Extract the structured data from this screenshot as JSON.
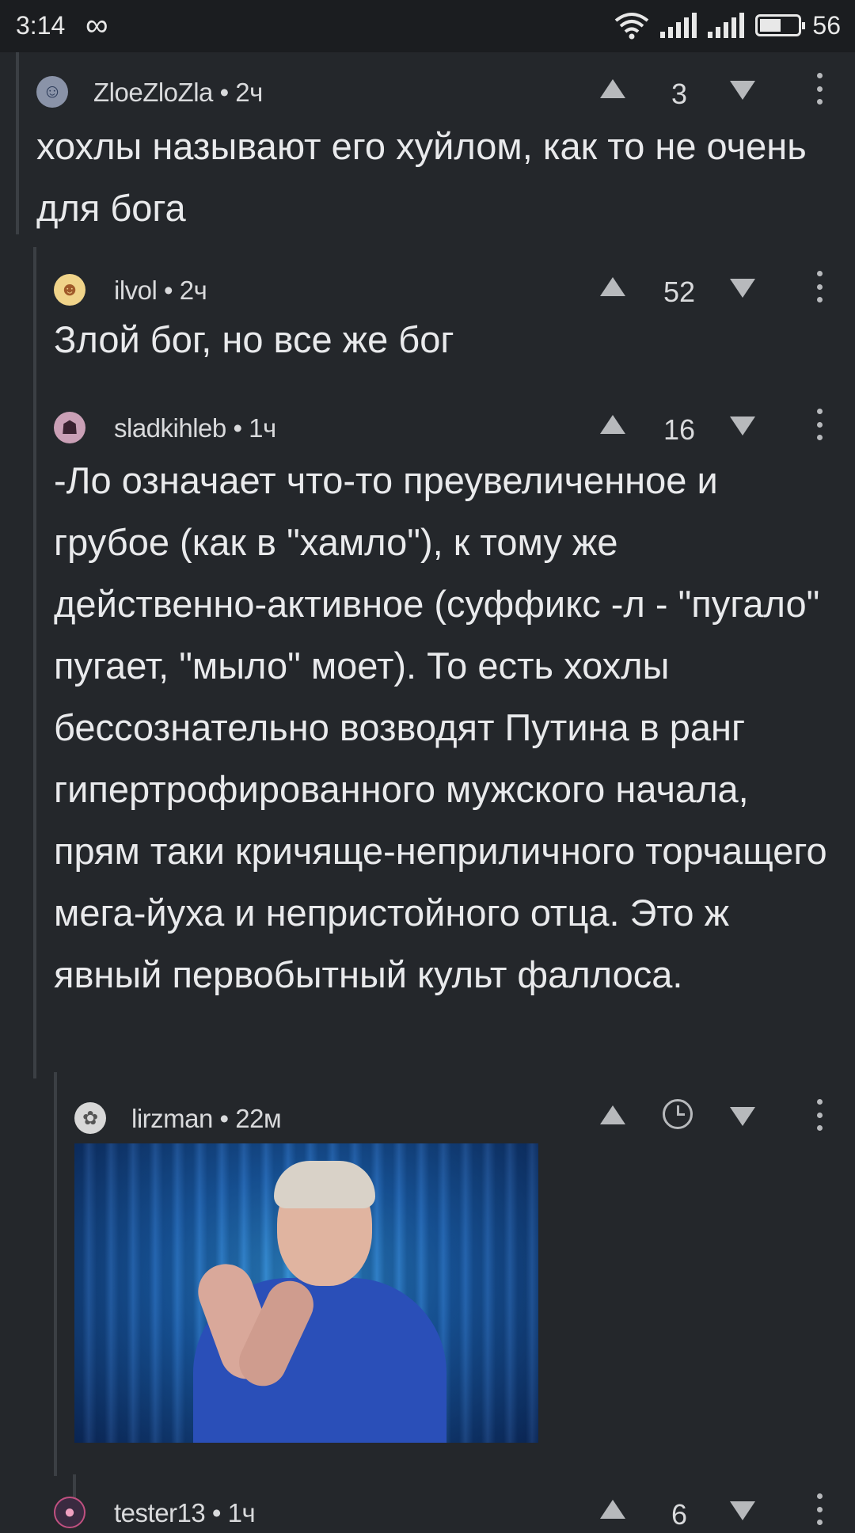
{
  "status_bar": {
    "time": "3:14",
    "infinity_symbol": "∞",
    "battery_level": "56",
    "battery_fill_fraction": 0.56
  },
  "comments": [
    {
      "author": "ZloeZloZla",
      "age": "2ч",
      "score": "3",
      "text": "хохлы называют его хуйлом, как то не очень для бога"
    },
    {
      "author": "ilvol",
      "age": "2ч",
      "score": "52",
      "text": "Злой бог, но все же бог"
    },
    {
      "author": "sladkihleb",
      "age": "1ч",
      "score": "16",
      "text": "-Ло означает что-то преувеличенное и грубое (как в \"хамло\"), к тому же действенно-активное (суффикс -л - \"пугало\" пугает, \"мыло\" моет). То есть хохлы бессознательно возводят Путина в ранг гипертрофированного мужского начала, прям таки кричяще-неприличного торчащего мега-йуха и непристойного отца. Это ж явный первобытный культ фаллоса."
    },
    {
      "author": "lirzman",
      "age": "22м",
      "score": "",
      "text": ""
    },
    {
      "author": "tester13",
      "age": "1ч",
      "score": "6",
      "text": ""
    }
  ],
  "separator": "•",
  "icons": {
    "upvote": "up-triangle",
    "downvote": "down-triangle",
    "more": "vertical-dots",
    "pending": "clock"
  }
}
